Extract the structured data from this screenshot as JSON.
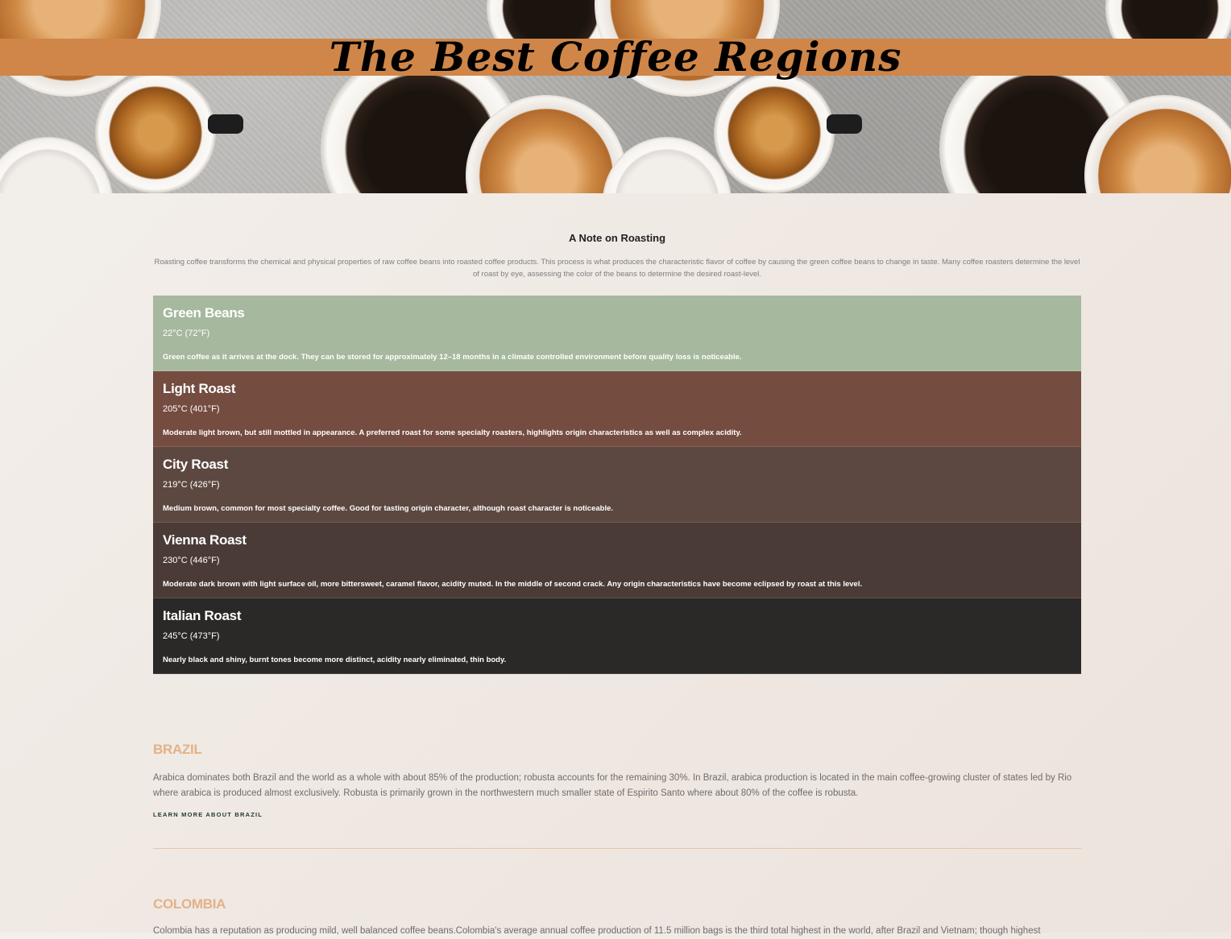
{
  "hero": {
    "title": "The Best Coffee Regions"
  },
  "note": {
    "heading": "A Note on Roasting",
    "text": "Roasting coffee transforms the chemical and physical properties of raw coffee beans into roasted coffee products. This process is what produces the characteristic flavor of coffee by causing the green coffee beans to change in taste. Many coffee roasters determine the level of roast by eye, assessing the color of the beans to determine the desired roast-level."
  },
  "roasts": [
    {
      "name": "Green Beans",
      "temp": "22°C (72°F)",
      "desc": "Green coffee as it arrives at the dock. They can be stored for approximately 12–18 months in a climate controlled environment before quality loss is noticeable.",
      "color": "#a6b89e"
    },
    {
      "name": "Light Roast",
      "temp": "205°C (401°F)",
      "desc": "Moderate light brown, but still mottled in appearance. A preferred roast for some specialty roasters, highlights origin characteristics as well as complex acidity.",
      "color": "#754c40"
    },
    {
      "name": "City Roast",
      "temp": "219°C (426°F)",
      "desc": "Medium brown, common for most specialty coffee. Good for tasting origin character, although roast character is noticeable.",
      "color": "#5c4840"
    },
    {
      "name": "Vienna Roast",
      "temp": "230°C (446°F)",
      "desc": "Moderate dark brown with light surface oil, more bittersweet, caramel flavor, acidity muted. In the middle of second crack. Any origin characteristics have become eclipsed by roast at this level.",
      "color": "#4a3b37"
    },
    {
      "name": "Italian Roast",
      "temp": "245°C (473°F)",
      "desc": "Nearly black and shiny, burnt tones become more distinct, acidity nearly eliminated, thin body.",
      "color": "#2b2928"
    }
  ],
  "regions": {
    "brazil": {
      "title": "BRAZIL",
      "text": "Arabica dominates both Brazil and the world as a whole with about 85% of the production; robusta accounts for the remaining 30%. In Brazil, arabica production is located in the main coffee-growing cluster of states led by Rio where arabica is produced almost exclusively. Robusta is primarily grown in the northwestern much smaller state of Espirito Santo where about 80% of the coffee is robusta.",
      "link": "LEARN MORE ABOUT BRAZIL"
    },
    "colombia": {
      "title": "COLOMBIA",
      "text": "Colombia has a reputation as producing mild, well balanced coffee beans.Colombia's average annual coffee production of 11.5 million bags is the third total highest in the world, after Brazil and Vietnam; though highest"
    }
  }
}
